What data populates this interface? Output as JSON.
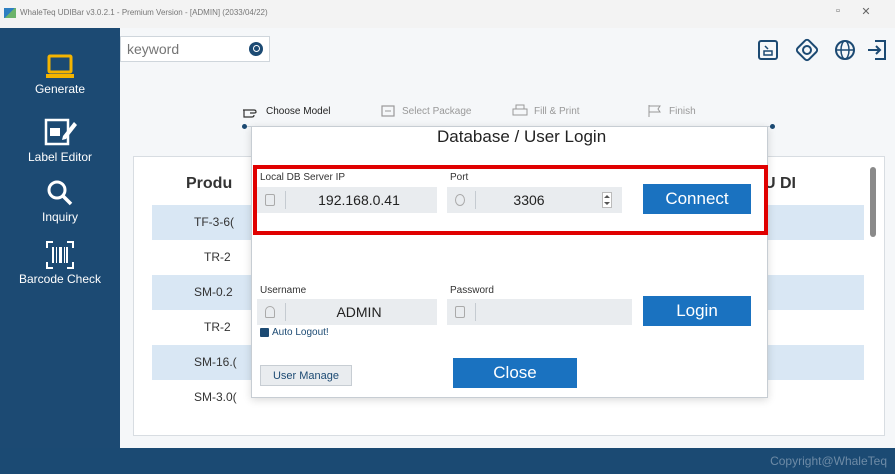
{
  "window": {
    "title": "WhaleTeq UDIBar v3.0.2.1 - Premium Version - [ADMIN] (2033/04/22)",
    "minimize_glyph": "▫",
    "close_glyph": "✕"
  },
  "sidebar": {
    "items": [
      {
        "label": "Generate",
        "icon": "laptop-icon"
      },
      {
        "label": "Label Editor",
        "icon": "edit-icon"
      },
      {
        "label": "Inquiry",
        "icon": "search-icon"
      },
      {
        "label": "Barcode Check",
        "icon": "barcode-icon"
      }
    ]
  },
  "search": {
    "placeholder": "keyword"
  },
  "toolbar_icons": [
    "device-icon",
    "settings-icon",
    "globe-icon",
    "logout-icon"
  ],
  "steps": [
    {
      "label": "Choose Model",
      "active": true
    },
    {
      "label": "Select Package",
      "active": false
    },
    {
      "label": "Fill & Print",
      "active": false
    },
    {
      "label": "Finish",
      "active": false
    }
  ],
  "table": {
    "headers": {
      "product": "Produ",
      "udi": "U DI"
    },
    "rows": [
      "TF-3-6(",
      "TR-2",
      "SM-0.2",
      "TR-2",
      "SM-16.(",
      "SM-3.0("
    ]
  },
  "dialog": {
    "title": "Database / User Login",
    "db_label": "Local DB Server IP",
    "db_value": "192.168.0.41",
    "port_label": "Port",
    "port_value": "3306",
    "connect_label": "Connect",
    "username_label": "Username",
    "username_value": "ADMIN",
    "password_label": "Password",
    "password_value": "",
    "login_label": "Login",
    "auto_logout_label": "Auto Logout!",
    "user_manage_label": "User Manage",
    "close_label": "Close"
  },
  "footer": {
    "copyright": "Copyright@WhaleTeq"
  },
  "colors": {
    "sidebar": "#1c4a73",
    "primary_button": "#1a72c0",
    "highlight": "#e00000"
  }
}
